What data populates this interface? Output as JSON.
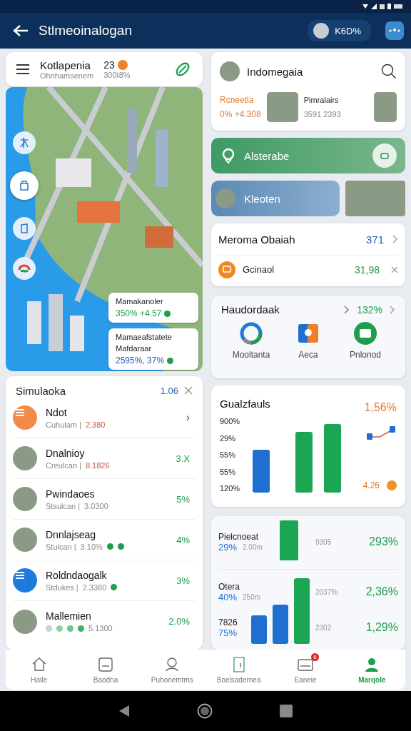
{
  "app_bar": {
    "title": "Stlmeoinalogan",
    "badge": "K6D%"
  },
  "left_header": {
    "title": "Kotlapenia",
    "subtitle": "Ohnhamsenem",
    "count": "23",
    "count_sub": "300t8%"
  },
  "map": {
    "tools": [
      {
        "selected": false
      },
      {
        "selected": true
      },
      {
        "selected": false
      },
      {
        "selected": false
      }
    ],
    "overlays": [
      {
        "title": "Mamakanoler",
        "value": "350% +4.57"
      },
      {
        "title": "Mamaeafstatete",
        "subtitle": "Mafdaraar",
        "value": "2595%, 37%"
      }
    ]
  },
  "list": {
    "title": "Simulaoka",
    "count": "1.06",
    "items": [
      {
        "kind": "icon",
        "color": "#f4894a",
        "name": "Ndot",
        "meta": "Cuhulam |",
        "value": "2,380",
        "highlight": true,
        "trail": "›"
      },
      {
        "kind": "photo",
        "name": "Dnalnioy",
        "meta": "Creulcan |",
        "value": "8.1826",
        "highlight": true,
        "trail": "3.X"
      },
      {
        "kind": "photo",
        "name": "Pwindaoes",
        "meta": "Stsulcan |",
        "value": "3.0300",
        "highlight": false,
        "trail": "5%"
      },
      {
        "kind": "photo",
        "name": "Dnnlajseag",
        "meta": "Stulcan |",
        "value": "3.10%",
        "highlight": false,
        "trail": "4%",
        "dots": [
          {
            "color": "#1e9e4a"
          },
          {
            "color": "#1e9e4a"
          }
        ]
      },
      {
        "kind": "icon",
        "color": "#1f7ae0",
        "name": "Roldndaogalk",
        "meta": "Stdukes |",
        "value": "2.3380",
        "highlight": false,
        "trail": "3%",
        "dots": [
          {
            "color": "#1e9e4a"
          }
        ]
      },
      {
        "kind": "photo",
        "name": "Mallemien",
        "value": "5.1300",
        "highlight": false,
        "trail": "2.0%",
        "dots": [
          {
            "color": "#c9d2cc"
          },
          {
            "color": "#8fd3a4"
          },
          {
            "color": "#6cc68a"
          },
          {
            "color": "#3fb068"
          }
        ]
      }
    ]
  },
  "profile": {
    "title": "Indomegaia",
    "stat_label": "Rcneetla",
    "stat_value": "0% +4.308",
    "feature_title": "Pimralairs",
    "feature_value": "3591 2393"
  },
  "banners": [
    {
      "kind": "green",
      "label": "Alsterabe"
    },
    {
      "kind": "blue",
      "label": "Kleoten"
    }
  ],
  "summary": {
    "title": "Meroma Obaiah",
    "count": "371",
    "item": {
      "label": "Gcinaol",
      "value": "31,98"
    }
  },
  "shortcuts": {
    "title": "Haudordaak",
    "value": "132%",
    "items": [
      {
        "kind": "ring",
        "label": "Mooltanta"
      },
      {
        "kind": "app",
        "label": "Aeca"
      },
      {
        "kind": "folder",
        "label": "Pnlonod"
      }
    ]
  },
  "chart_card": {
    "title": "Gualzfauls",
    "value": "1,56%",
    "axis_labels": [
      "900%",
      "29%",
      "55%",
      "55%",
      "120%"
    ],
    "footer": "4.26"
  },
  "stats_card": {
    "rows": [
      {
        "title": "Pielcnoeat",
        "pct": "29%",
        "amount": "2.00m",
        "mid": "9305",
        "change": "293%"
      },
      {
        "title": "Otera",
        "pct": "40%",
        "amount": "250m",
        "mid": "2037%",
        "change": "2,36%"
      },
      {
        "title": "7826",
        "pct": "75%",
        "mid": "2302",
        "change": "1,29%"
      }
    ]
  },
  "bottom_nav": [
    {
      "label": "Haile",
      "selected": false
    },
    {
      "label": "Baodna",
      "selected": false
    },
    {
      "label": "Puhonemtms",
      "selected": false
    },
    {
      "label": "Boelsadernea",
      "selected": false
    },
    {
      "label": "Eaneie",
      "selected": false,
      "badge": "6"
    },
    {
      "label": "Marqole",
      "selected": true
    }
  ]
}
